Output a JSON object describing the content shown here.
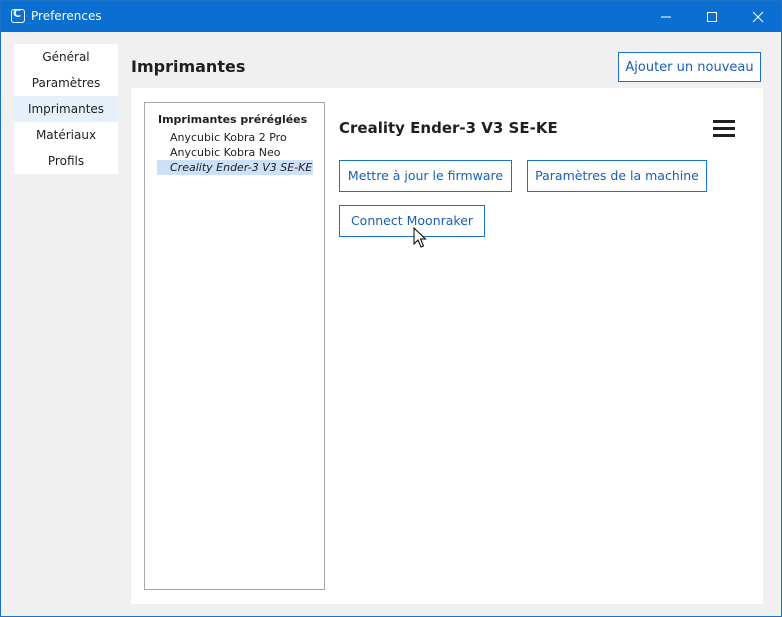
{
  "window": {
    "title": "Preferences",
    "app_icon_letter": "C"
  },
  "sidebar": {
    "items": [
      {
        "label": "Général"
      },
      {
        "label": "Paramètres"
      },
      {
        "label": "Imprimantes"
      },
      {
        "label": "Matériaux"
      },
      {
        "label": "Profils"
      }
    ],
    "active_index": 2
  },
  "main": {
    "section_title": "Imprimantes",
    "add_new_label": "Ajouter un nouveau"
  },
  "printer_list": {
    "header": "Imprimantes préréglées",
    "items": [
      {
        "label": "Anycubic Kobra 2 Pro"
      },
      {
        "label": "Anycubic Kobra Neo"
      },
      {
        "label": "Creality Ender-3 V3 SE-KE"
      }
    ],
    "selected_index": 2
  },
  "printer_detail": {
    "name": "Creality Ender-3 V3 SE-KE",
    "buttons": {
      "update_firmware": "Mettre à jour le firmware",
      "machine_settings": "Paramètres de la machine",
      "connect_moonraker": "Connect Moonraker"
    }
  },
  "colors": {
    "titlebar": "#0a6fd0",
    "accent": "#1a73c8",
    "selected": "#cce0f7"
  }
}
